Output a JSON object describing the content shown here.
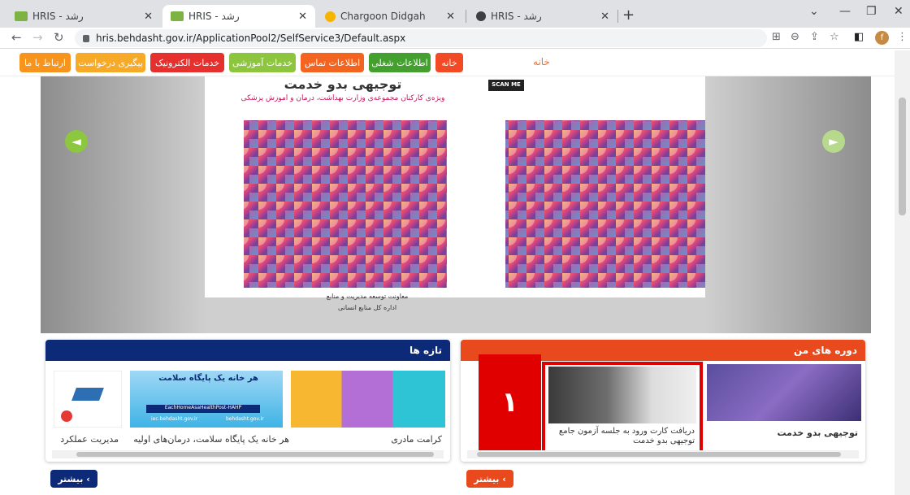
{
  "browser": {
    "tabs": [
      {
        "label": "رشد - HRIS"
      },
      {
        "label": "رشد - HRIS"
      },
      {
        "label": "Chargoon Didgah"
      },
      {
        "label": "رشد - HRIS"
      }
    ],
    "url": "hris.behdasht.gov.ir/ApplicationPool2/SelfService3/Default.aspx",
    "profile_initial": "f"
  },
  "menu": {
    "items": [
      {
        "label": "خانه",
        "color": "#f24a24"
      },
      {
        "label": "اطلاعات شغلی",
        "color": "#43a02e"
      },
      {
        "label": "اطلاعات تماس",
        "color": "#f46421"
      },
      {
        "label": "خدمات آموزشی",
        "color": "#8ec53f"
      },
      {
        "label": "خدمات الکترونیک",
        "color": "#e5302d"
      },
      {
        "label": "پیگیری درخواست",
        "color": "#f7a928"
      },
      {
        "label": "ارتباط با ما",
        "color": "#f7941d"
      }
    ],
    "breadcrumb": "خانه"
  },
  "slider": {
    "book_title": "توجیهی بدو خدمت",
    "book_subtitle": "ویژه‌ی کارکنان مجموعه‌ی وزارت بهداشت، درمان و آموزش پزشکی",
    "book_footer_1": "معاونت توسعه مدیریت و منابع",
    "book_footer_2": "اداره کل منابع انسانی",
    "scan_label": "SCAN ME",
    "accent": "#8dc63f"
  },
  "my_courses": {
    "title": "دوره های من",
    "header_color": "#e8491d",
    "items": [
      {
        "caption": "توجیهی بدو خدمت"
      },
      {
        "caption": "دریافت کارت ورود به جلسه آزمون جامع توجیهی بدو خدمت"
      }
    ],
    "highlight_number": "۱",
    "more_label": "بیشتر",
    "more_color": "#e8491d"
  },
  "news": {
    "title": "تازه ها",
    "header_color": "#0d2a78",
    "items": [
      {
        "caption": "کرامت مادری"
      },
      {
        "caption": "هر خانه یک پایگاه سلامت، درمان‌های اولیه"
      },
      {
        "caption": "مدیریت عملکرد"
      }
    ],
    "poster_title": "هر خانه یک پایگاه سلامت",
    "poster_tag": "EachHomeAsaHealthPost-HAHP",
    "poster_url_1": "iec.behdasht.gov.ir",
    "poster_url_2": "behdasht.gov.ir",
    "more_label": "بیشتر",
    "more_color": "#0d2a78"
  }
}
